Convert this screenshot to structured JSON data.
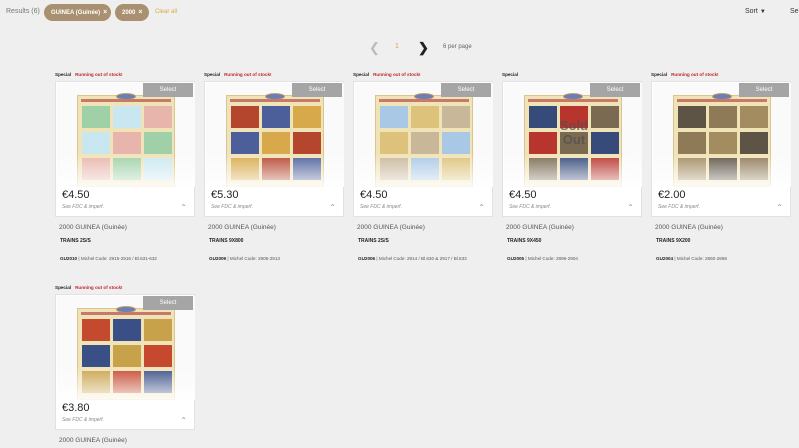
{
  "toolbar": {
    "results": "Results (6)",
    "filters": [
      "GUINEA (Guinée)",
      "2000"
    ],
    "clear_all": "Clear all",
    "sort": "Sort",
    "search_cut": "Se"
  },
  "pagination": {
    "current_page": "1",
    "per_page": "6 per page"
  },
  "colors": {
    "accent": "#d8a93a",
    "chip": "#a89070",
    "out_of_stock": "#c0262d",
    "select_button": "#a5a5a5"
  },
  "products": [
    {
      "tag": "Special",
      "stock": "Running out of stock!",
      "select": "Select",
      "sold_out": "",
      "price": "€4.50",
      "sub": "See FDC & imperf.",
      "country": "2000 GUINEA (Guinée)",
      "title": "TRAINS 2S/S",
      "code": "GU2010",
      "michel": "Michel Code: 2915-2916 / Bl.631-632"
    },
    {
      "tag": "Special",
      "stock": "Running out of stock!",
      "select": "Select",
      "sold_out": "",
      "price": "€5.30",
      "sub": "See FDC & imperf.",
      "country": "2000 GUINEA (Guinée)",
      "title": "TRAINS 9X800",
      "code": "GU2009",
      "michel": "Michel Code: 2905-2913"
    },
    {
      "tag": "Special",
      "stock": "Running out of stock!",
      "select": "Select",
      "sold_out": "",
      "price": "€4.50",
      "sub": "See FDC & imperf.",
      "country": "2000 GUINEA (Guinée)",
      "title": "TRAINS 2S/S",
      "code": "GU2006",
      "michel": "Michel Code: 2914 / Bl.630 & 2917 / Bl.633"
    },
    {
      "tag": "Special",
      "stock": "",
      "select": "Select",
      "sold_out": "Sold Out",
      "price": "€4.50",
      "sub": "See FDC & imperf.",
      "country": "2000 GUINEA (Guinée)",
      "title": "TRAINS 9X450",
      "code": "GU2005",
      "michel": "Michel Code: 2896-2904"
    },
    {
      "tag": "Special",
      "stock": "Running out of stock!",
      "select": "Select",
      "sold_out": "",
      "price": "€2.00",
      "sub": "See FDC & imperf.",
      "country": "2000 GUINEA (Guinée)",
      "title": "TRAINS 9X200",
      "code": "GU2004",
      "michel": "Michel Code: 2860-2868"
    },
    {
      "tag": "Special",
      "stock": "Running out of stock!",
      "select": "Select",
      "sold_out": "",
      "price": "€3.80",
      "sub": "See FDC & imperf.",
      "country": "2000 GUINEA (Guinée)",
      "title": "",
      "code": "",
      "michel": ""
    }
  ]
}
